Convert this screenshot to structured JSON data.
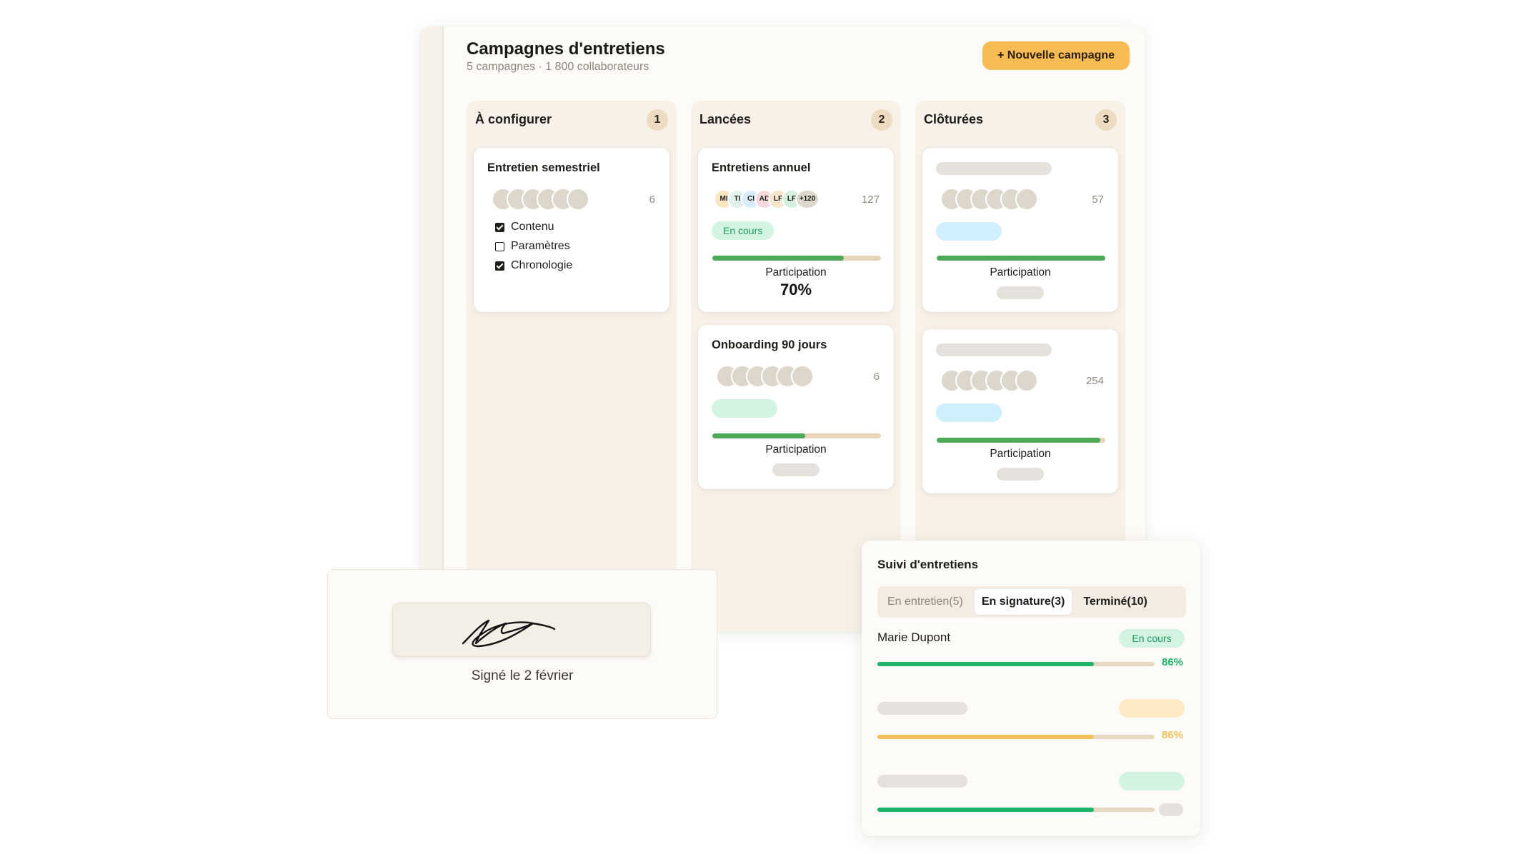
{
  "header": {
    "title": "Campagnes d'entretiens",
    "subtitle": "5 campagnes  ·  1 800 collaborateurs",
    "new_campaign_label": "+ Nouvelle campagne"
  },
  "columns": [
    {
      "title": "À configurer",
      "count": "1",
      "cards": [
        {
          "title": "Entretien semestriel",
          "count": "6",
          "checklist": [
            {
              "label": "Contenu",
              "checked": true
            },
            {
              "label": "Paramètres",
              "checked": false
            },
            {
              "label": "Chronologie",
              "checked": true
            }
          ]
        }
      ]
    },
    {
      "title": "Lancées",
      "count": "2",
      "cards": [
        {
          "title": "Entretiens annuel",
          "avatars": [
            "MI",
            "TI",
            "CI",
            "AD",
            "LF",
            "LF",
            "+120"
          ],
          "count": "127",
          "status": "En cours",
          "participation_label": "Participation",
          "participation_value": "70%",
          "progress": 0.78
        },
        {
          "title": "Onboarding 90 jours",
          "count": "6",
          "participation_label": "Participation",
          "progress": 0.55
        }
      ]
    },
    {
      "title": "Clôturées",
      "count": "3",
      "cards": [
        {
          "count": "57",
          "participation_label": "Participation",
          "progress": 1.0
        },
        {
          "count": "254",
          "participation_label": "Participation",
          "progress": 0.97
        }
      ]
    }
  ],
  "signature": {
    "caption": "Signé le 2 février"
  },
  "suivi": {
    "title": "Suivi d'entretiens",
    "tabs": [
      "En entretien(5)",
      "En signature(3)",
      "Terminé(10)"
    ],
    "active_tab": 1,
    "rows": [
      {
        "name": "Marie Dupont",
        "status": "En cours",
        "percent": "86%",
        "progress": 0.78,
        "color": "#1fb26a"
      },
      {
        "percent": "86%",
        "progress": 0.78,
        "color": "#f6c05a"
      },
      {
        "progress": 0.78,
        "color": "#1fb26a"
      }
    ]
  },
  "colors": {
    "accent": "#f9bc54",
    "success": "#1fb26a",
    "progress_green": "#4ba958",
    "warning": "#f6c05a"
  }
}
